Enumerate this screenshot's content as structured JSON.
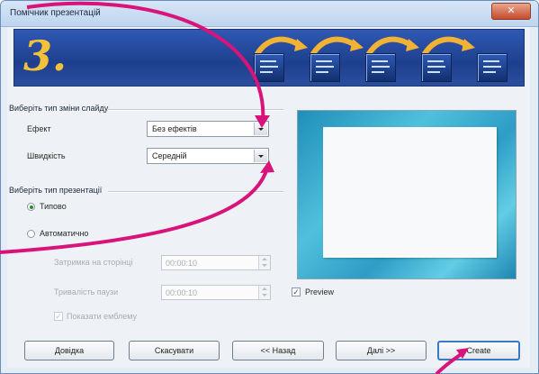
{
  "window": {
    "title": "Помічник презентацій",
    "close_glyph": "✕"
  },
  "banner": {
    "step_number": "3."
  },
  "transition_group": {
    "title": "Виберіть тип зміни слайду",
    "effect_label": "Ефект",
    "effect_value": "Без ефектів",
    "speed_label": "Швидкість",
    "speed_value": "Середній"
  },
  "presentation_group": {
    "title": "Виберіть тип презентації",
    "option_default": "Типово",
    "option_auto": "Автоматично",
    "selected": "Типово",
    "page_delay_label": "Затримка на сторінці",
    "page_delay_value": "00:00:10",
    "pause_label": "Тривалість паузи",
    "pause_value": "00:00:10",
    "show_logo_label": "Показати емблему",
    "show_logo_checked": true
  },
  "preview": {
    "label": "Preview",
    "checked": true
  },
  "buttons": {
    "help": "Довідка",
    "cancel": "Скасувати",
    "back": "<< Назад",
    "next": "Далі >>",
    "create": "Create"
  },
  "colors": {
    "annotation_arrow": "#d8137a",
    "banner_blue": "#1e3f8d",
    "banner_number": "#f3c23a",
    "arrow_orange": "#f2b233"
  },
  "icons": {
    "checkmark": "✓"
  }
}
